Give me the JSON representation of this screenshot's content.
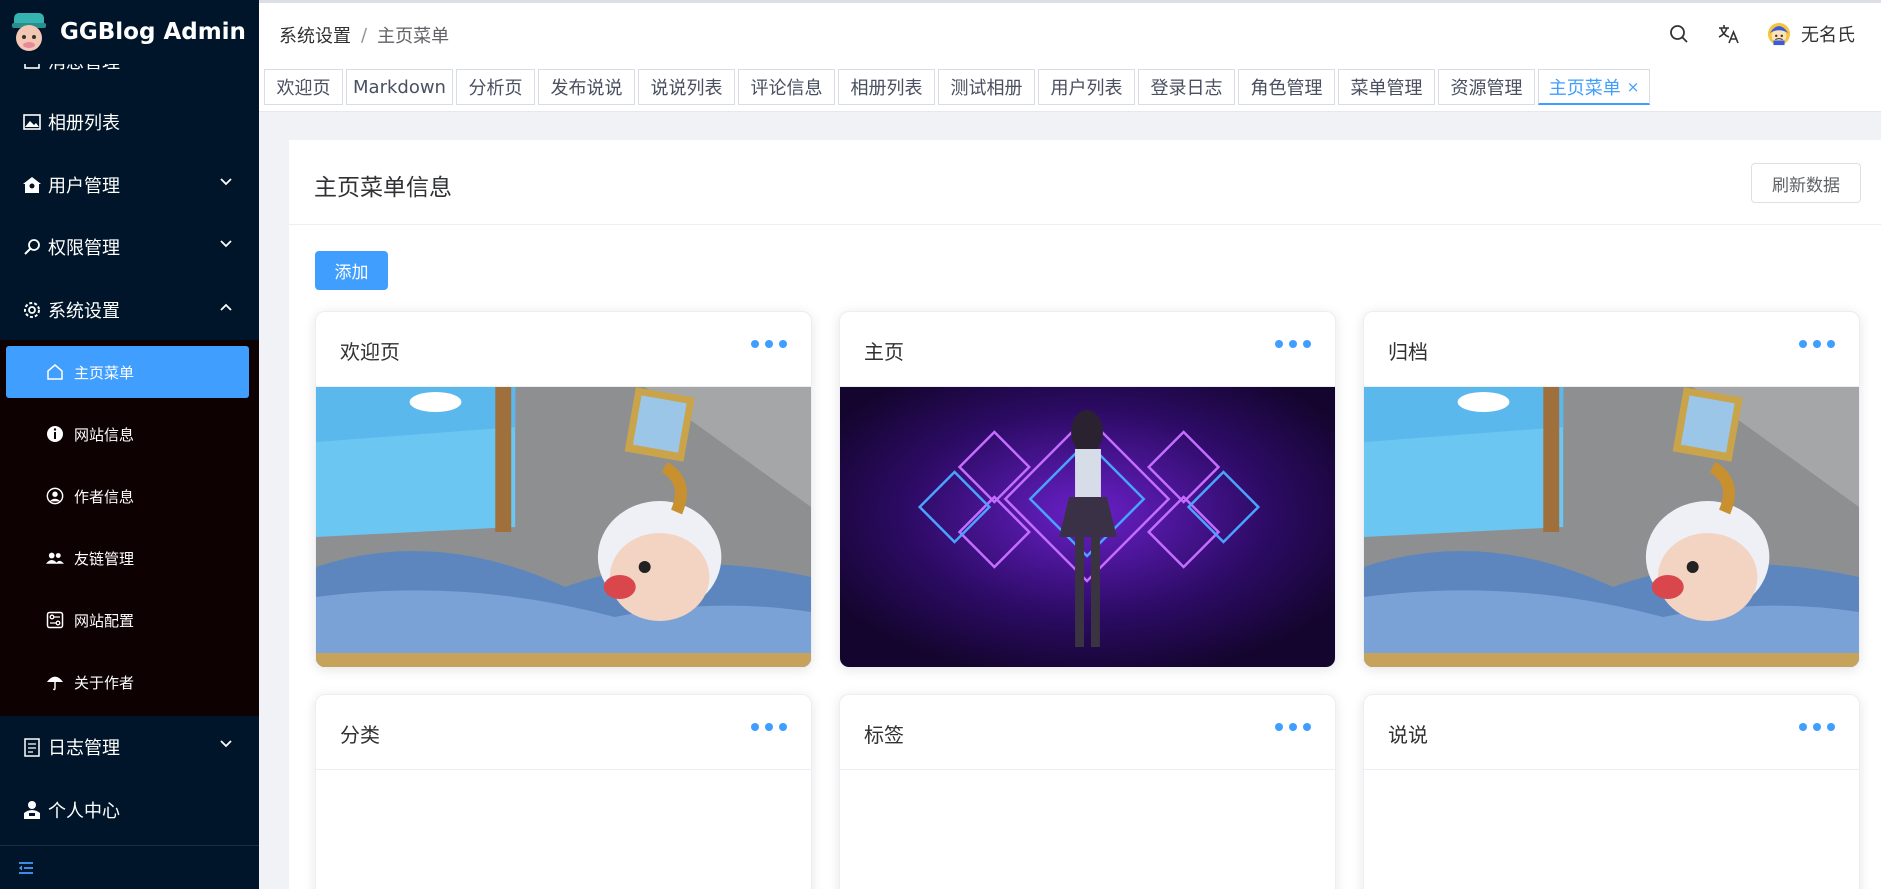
{
  "app": {
    "title": "GGBlog Admin"
  },
  "sidebar": {
    "partial_item_label": "消息管理",
    "items": [
      {
        "label": "相册列表",
        "icon": "image-icon"
      },
      {
        "label": "用户管理",
        "icon": "user-group-icon"
      },
      {
        "label": "权限管理",
        "icon": "key-icon"
      },
      {
        "label": "系统设置",
        "icon": "gear-icon"
      },
      {
        "label": "日志管理",
        "icon": "document-icon"
      },
      {
        "label": "个人中心",
        "icon": "person-icon"
      }
    ],
    "system_submenu": [
      {
        "label": "主页菜单",
        "icon": "home-icon",
        "active": true
      },
      {
        "label": "网站信息",
        "icon": "info-icon"
      },
      {
        "label": "作者信息",
        "icon": "user-circle-icon"
      },
      {
        "label": "友链管理",
        "icon": "people-icon"
      },
      {
        "label": "网站配置",
        "icon": "config-icon"
      },
      {
        "label": "关于作者",
        "icon": "umbrella-icon"
      }
    ],
    "collapse_icon": "menu-fold-icon"
  },
  "header": {
    "breadcrumb": [
      "系统设置",
      "主页菜单"
    ],
    "breadcrumb_separator": "/",
    "username": "无名氏",
    "icons": [
      "search-icon",
      "translate-icon",
      "avatar"
    ]
  },
  "tabs": [
    {
      "label": "欢迎页"
    },
    {
      "label": "Markdown"
    },
    {
      "label": "分析页"
    },
    {
      "label": "发布说说"
    },
    {
      "label": "说说列表"
    },
    {
      "label": "评论信息"
    },
    {
      "label": "相册列表"
    },
    {
      "label": "测试相册"
    },
    {
      "label": "用户列表"
    },
    {
      "label": "登录日志"
    },
    {
      "label": "角色管理"
    },
    {
      "label": "菜单管理"
    },
    {
      "label": "资源管理"
    },
    {
      "label": "主页菜单",
      "active": true,
      "close": "×"
    }
  ],
  "main": {
    "title": "主页菜单信息",
    "refresh_label": "刷新数据",
    "add_label": "添加",
    "cards": [
      {
        "title": "欢迎页",
        "image": "cartoon-sheep-sleeping"
      },
      {
        "title": "主页",
        "image": "neon-girl-purple"
      },
      {
        "title": "归档",
        "image": "cartoon-sheep-sleeping"
      },
      {
        "title": "分类",
        "image": ""
      },
      {
        "title": "标签",
        "image": ""
      },
      {
        "title": "说说",
        "image": ""
      }
    ]
  },
  "colors": {
    "sidebar_bg": "#001529",
    "submenu_bg": "#0d0102",
    "accent": "#409eff",
    "page_bg": "#f0f2f5"
  }
}
